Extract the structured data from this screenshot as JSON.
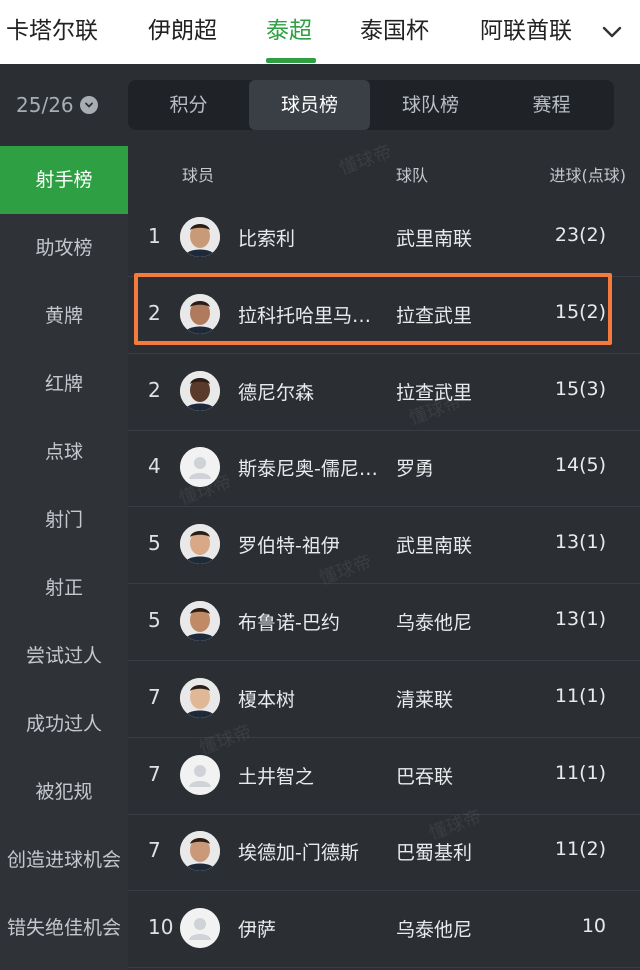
{
  "leagues": [
    "卡塔尔联",
    "伊朗超",
    "泰超",
    "泰国杯",
    "阿联酋联"
  ],
  "active_league": "泰超",
  "season": "25/26",
  "subtabs": [
    "积分",
    "球员榜",
    "球队榜",
    "赛程"
  ],
  "active_subtab": "球员榜",
  "sidebar": [
    "射手榜",
    "助攻榜",
    "黄牌",
    "红牌",
    "点球",
    "射门",
    "射正",
    "尝试过人",
    "成功过人",
    "被犯规",
    "创造进球机会",
    "错失绝佳机会"
  ],
  "active_sidebar": "射手榜",
  "table": {
    "headers": {
      "player": "球员",
      "team": "球队",
      "goals": "进球(点球)"
    },
    "rows": [
      {
        "rank": "1",
        "player": "比索利",
        "team": "武里南联",
        "goals": "23(2)",
        "avatar": "photo"
      },
      {
        "rank": "2",
        "player": "拉科托哈里马…",
        "team": "拉查武里",
        "goals": "15(2)",
        "avatar": "photo"
      },
      {
        "rank": "2",
        "player": "德尼尔森",
        "team": "拉查武里",
        "goals": "15(3)",
        "avatar": "photo"
      },
      {
        "rank": "4",
        "player": "斯泰尼奥-儒尼…",
        "team": "罗勇",
        "goals": "14(5)",
        "avatar": "placeholder"
      },
      {
        "rank": "5",
        "player": "罗伯特-祖伊",
        "team": "武里南联",
        "goals": "13(1)",
        "avatar": "photo"
      },
      {
        "rank": "5",
        "player": "布鲁诺-巴约",
        "team": "乌泰他尼",
        "goals": "13(1)",
        "avatar": "photo"
      },
      {
        "rank": "7",
        "player": "榎本树",
        "team": "清莱联",
        "goals": "11(1)",
        "avatar": "photo"
      },
      {
        "rank": "7",
        "player": "土井智之",
        "team": "巴吞联",
        "goals": "11(1)",
        "avatar": "placeholder"
      },
      {
        "rank": "7",
        "player": "埃德加-门德斯",
        "team": "巴蜀基利",
        "goals": "11(2)",
        "avatar": "photo"
      },
      {
        "rank": "10",
        "player": "伊萨",
        "team": "乌泰他尼",
        "goals": "10",
        "avatar": "placeholder"
      }
    ]
  },
  "watermark": "懂球帝",
  "colors": {
    "accent": "#2ea043",
    "highlight": "#f47b3c",
    "background": "#2b2f34"
  }
}
